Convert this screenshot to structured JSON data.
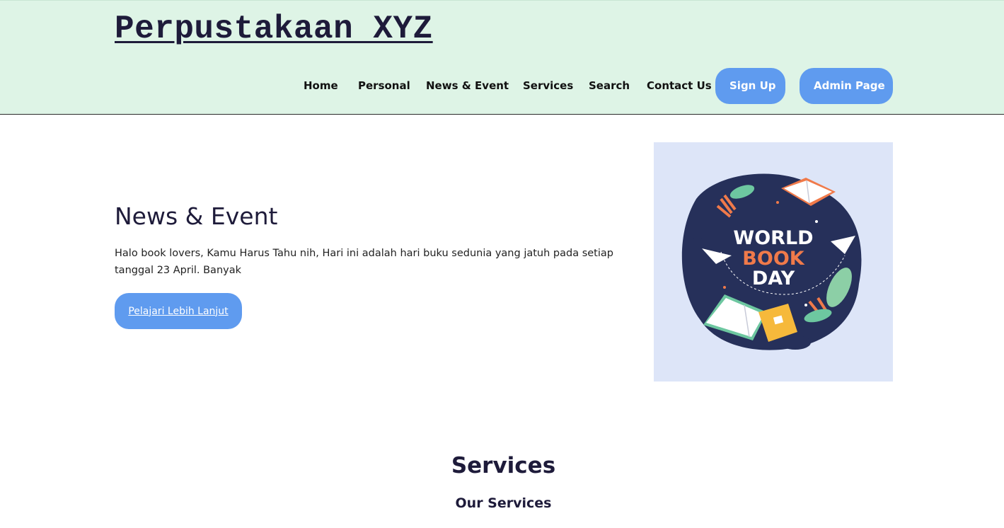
{
  "header": {
    "site_title": "Perpustakaan XYZ",
    "nav": {
      "home": "Home",
      "personal": "Personal",
      "news_event": "News & Event",
      "services": "Services",
      "search": "Search",
      "contact": "Contact Us",
      "signup": "Sign Up",
      "admin": "Admin Page"
    }
  },
  "hero": {
    "title": "News & Event",
    "description": " Halo book lovers, Kamu Harus Tahu nih, Hari ini adalah hari buku sedunia yang jatuh pada setiap tanggal 23 April. Banyak",
    "button_label": "Pelajari Lebih Lanjut",
    "image": {
      "line1": "WORLD",
      "line2": "BOOK",
      "line3": "DAY"
    }
  },
  "services": {
    "title": "Services",
    "subtitle": "Our Services"
  },
  "colors": {
    "header_bg": "#def4e6",
    "button_bg": "#5f9bef",
    "image_bg": "#dde5f8",
    "globe": "#26305a",
    "accent_orange": "#f07a4a"
  }
}
